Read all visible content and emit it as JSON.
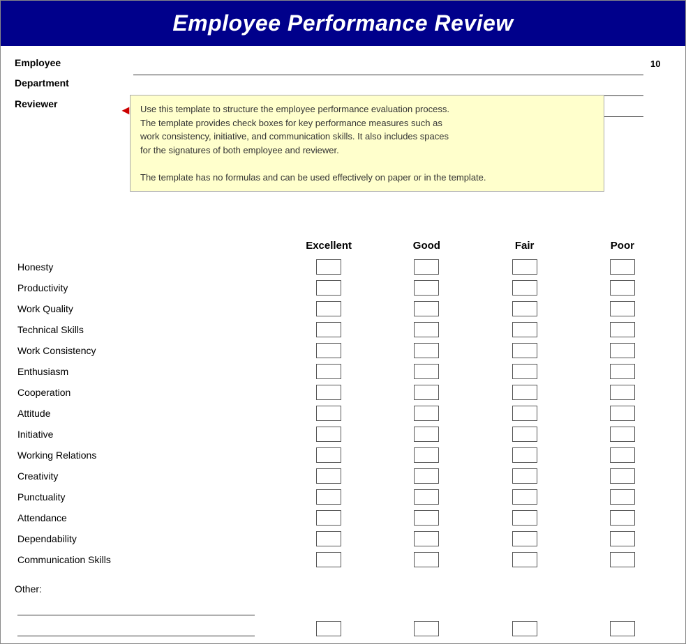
{
  "header": {
    "title": "Employee Performance Review"
  },
  "tooltip": {
    "text1": "Use this template to structure the employee performance evaluation process.",
    "text2": "The template provides check boxes for key performance measures such as",
    "text3": "work consistency, initiative, and communication skills. It also includes spaces",
    "text4": "for the signatures of both employee and reviewer.",
    "text5": "The template has no formulas and can be used effectively on paper or in the template."
  },
  "employee_fields": [
    {
      "label": "Employee"
    },
    {
      "label": "Department"
    },
    {
      "label": "Reviewer"
    }
  ],
  "right_label": "10",
  "rating_headers": [
    "Excellent",
    "Good",
    "Fair",
    "Poor"
  ],
  "criteria": [
    "Honesty",
    "Productivity",
    "Work Quality",
    "Technical Skills",
    "Work Consistency",
    "Enthusiasm",
    "Cooperation",
    "Attitude",
    "Initiative",
    "Working Relations",
    "Creativity",
    "Punctuality",
    "Attendance",
    "Dependability",
    "Communication Skills"
  ],
  "other_label": "Other:"
}
